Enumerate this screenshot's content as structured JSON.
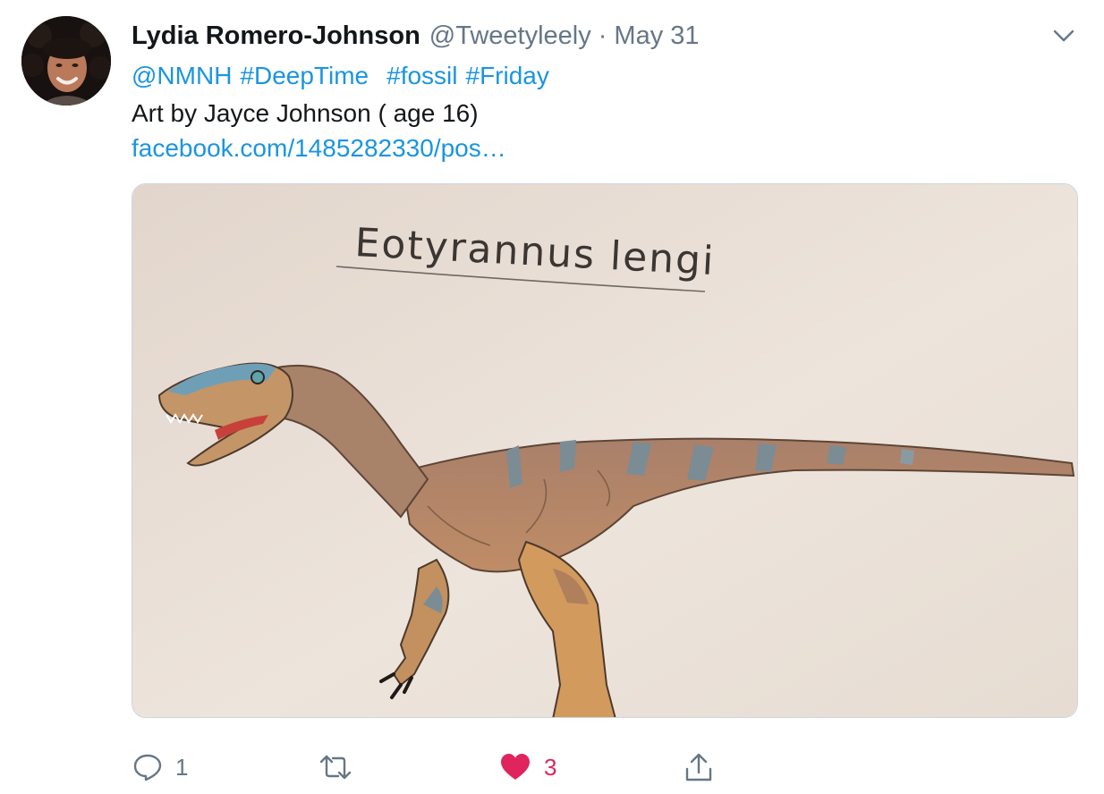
{
  "tweet": {
    "author": {
      "display_name": "Lydia Romero-Johnson",
      "handle": "@Tweetyleely",
      "separator": "·",
      "date": "May 31",
      "avatar_icon": "profile-photo"
    },
    "menu_icon": "chevron-down-icon",
    "text": {
      "mentions": [
        "@NMNH"
      ],
      "hashtags": [
        "#DeepTime",
        "#fossil",
        "#Friday"
      ],
      "caption": "Art by Jayce Johnson ( age 16)",
      "link": "facebook.com/1485282330/pos…"
    },
    "media": {
      "handwritten_title": "Eotyrannus lengi",
      "subject": "colored pencil drawing of a feathered dinosaur"
    },
    "actions": {
      "reply_icon": "reply-icon",
      "reply_count": "1",
      "retweet_icon": "retweet-icon",
      "retweet_count": "",
      "like_icon": "heart-icon",
      "like_count": "3",
      "liked": true,
      "share_icon": "share-icon"
    },
    "colors": {
      "link": "#1b95e0",
      "secondary_text": "#657786",
      "like": "#e0245e",
      "border": "#ccd6dd"
    }
  }
}
